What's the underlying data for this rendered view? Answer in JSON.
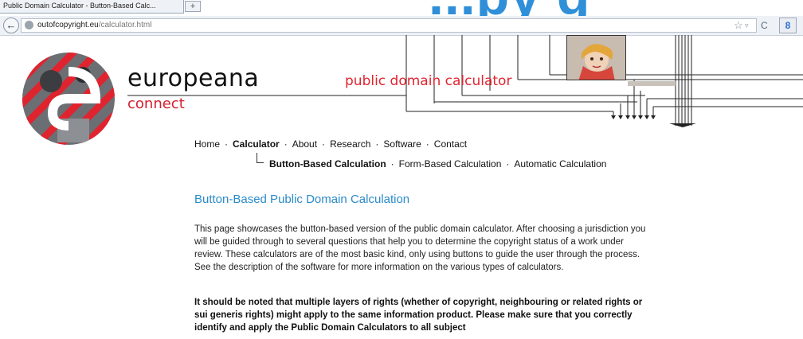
{
  "browser": {
    "tab_title": "Public Domain Calculator - Button-Based Calc...",
    "new_tab_label": "+",
    "back_symbol": "←",
    "url_host": "outofcopyright.eu",
    "url_path": "/calculator.html",
    "star_symbol": "☆",
    "dropdown_symbol": "▿",
    "reload_symbol": "C",
    "search_engine_symbol": "8",
    "overlay_text": "...py g"
  },
  "logo": {
    "brand": "europeana",
    "sub": "connect"
  },
  "banner": {
    "title": "public domain calculator"
  },
  "nav": {
    "items": [
      "Home",
      "Calculator",
      "About",
      "Research",
      "Software",
      "Contact"
    ],
    "active": "Calculator",
    "sub_items": [
      "Button-Based Calculation",
      "Form-Based Calculation",
      "Automatic Calculation"
    ],
    "sub_active": "Button-Based Calculation",
    "separator": "·"
  },
  "content": {
    "heading": "Button-Based Public Domain Calculation",
    "paragraph1": "This page showcases the button-based version of the public domain calculator. After choosing a jurisdiction you will be guided through to several questions that help you to determine the copyright status of a work under review. These calculators are of the most basic kind, only using buttons to guide the user through the process. See the description of the software for more information on the various types of calculators.",
    "paragraph2": "It should be noted that multiple layers of rights (whether of copyright, neighbouring or related rights or sui generis rights) might apply to the same information product. Please make sure that you correctly identify and apply the Public Domain Calculators to all subject"
  },
  "colors": {
    "brand_red": "#e0242f",
    "heading_blue": "#2b8bc9"
  }
}
